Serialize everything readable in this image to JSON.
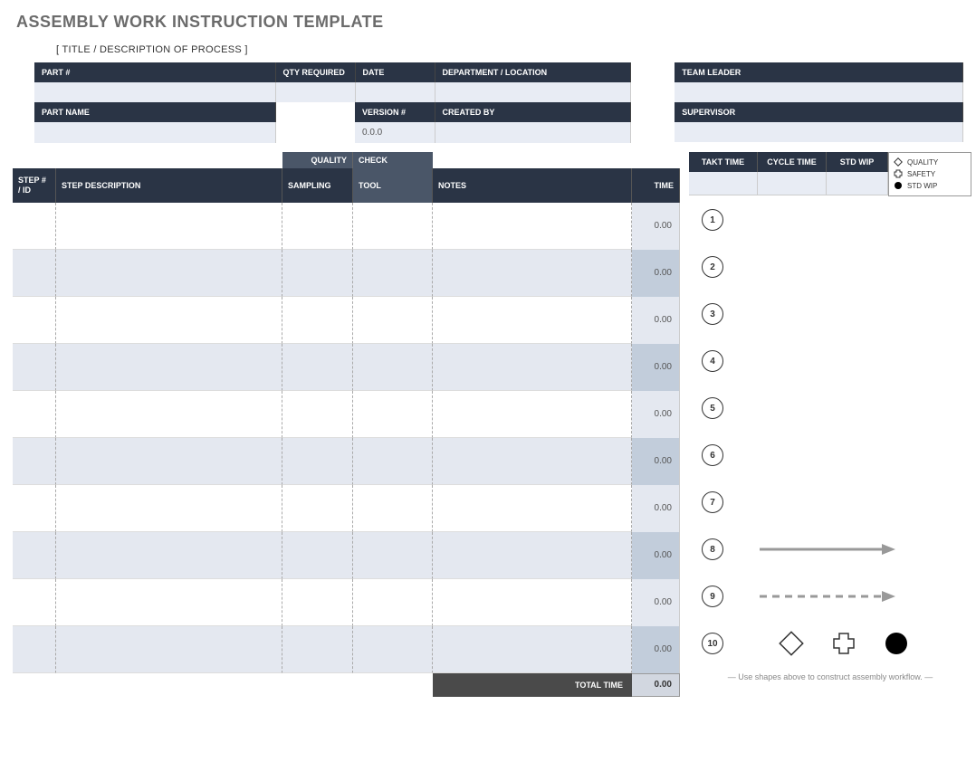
{
  "title": "ASSEMBLY WORK INSTRUCTION TEMPLATE",
  "subtitle": "[ TITLE / DESCRIPTION OF PROCESS ]",
  "info": {
    "part_num_label": "PART #",
    "qty_label": "QTY REQUIRED",
    "date_label": "DATE",
    "dept_label": "DEPARTMENT / LOCATION",
    "part_name_label": "PART NAME",
    "version_label": "VERSION #",
    "created_label": "CREATED BY",
    "version_value": "0.0.0",
    "team_leader_label": "TEAM LEADER",
    "supervisor_label": "SUPERVISOR"
  },
  "quality_check": {
    "quality": "QUALITY",
    "check": "CHECK"
  },
  "steps_header": {
    "step_id": "STEP # / ID",
    "desc": "STEP DESCRIPTION",
    "sampling": "SAMPLING",
    "tool": "TOOL",
    "notes": "NOTES",
    "time": "TIME"
  },
  "steps": [
    {
      "time": "0.00"
    },
    {
      "time": "0.00"
    },
    {
      "time": "0.00"
    },
    {
      "time": "0.00"
    },
    {
      "time": "0.00"
    },
    {
      "time": "0.00"
    },
    {
      "time": "0.00"
    },
    {
      "time": "0.00"
    },
    {
      "time": "0.00"
    },
    {
      "time": "0.00"
    }
  ],
  "total": {
    "label": "TOTAL TIME",
    "value": "0.00"
  },
  "time_header": {
    "takt": "TAKT TIME",
    "cycle": "CYCLE TIME",
    "std": "STD WIP"
  },
  "legend": {
    "quality": "QUALITY",
    "safety": "SAFETY",
    "stdwip": "STD WIP"
  },
  "workflow_numbers": [
    "1",
    "2",
    "3",
    "4",
    "5",
    "6",
    "7",
    "8",
    "9",
    "10"
  ],
  "workflow_note": "—   Use shapes above to construct assembly workflow.   —"
}
